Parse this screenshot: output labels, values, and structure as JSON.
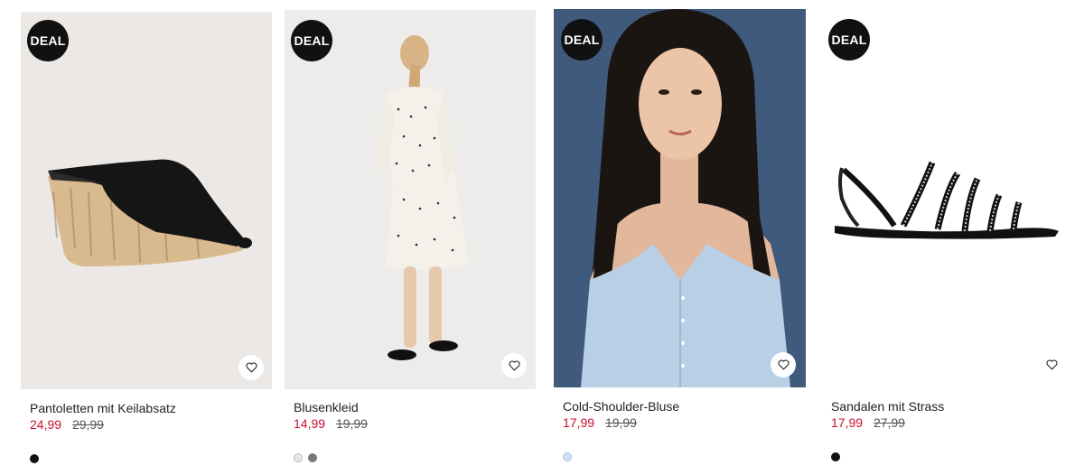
{
  "products": [
    {
      "deal_label": "DEAL",
      "name": "Pantoletten mit Keilabsatz",
      "price_sale": "24,99",
      "price_old": "29,99",
      "swatches": [
        "#111111"
      ],
      "image_icon": "wedge-mule-product-image",
      "favorite_icon": "heart-icon"
    },
    {
      "deal_label": "DEAL",
      "name": "Blusenkleid",
      "price_sale": "14,99",
      "price_old": "19,99",
      "swatches": [
        "#e8e8e8",
        "#777777"
      ],
      "image_icon": "dress-model-product-image",
      "favorite_icon": "heart-icon"
    },
    {
      "deal_label": "DEAL",
      "name": "Cold-Shoulder-Bluse",
      "price_sale": "17,99",
      "price_old": "19,99",
      "swatches": [
        "#cfe0f2"
      ],
      "image_icon": "blouse-model-product-image",
      "favorite_icon": "heart-icon"
    },
    {
      "deal_label": "DEAL",
      "name": "Sandalen mit Strass",
      "price_sale": "17,99",
      "price_old": "27,99",
      "swatches": [
        "#111111"
      ],
      "image_icon": "sandal-product-image",
      "favorite_icon": "heart-icon"
    }
  ],
  "colors": {
    "sale_price": "#c8102e",
    "deal_badge": "#111111"
  }
}
